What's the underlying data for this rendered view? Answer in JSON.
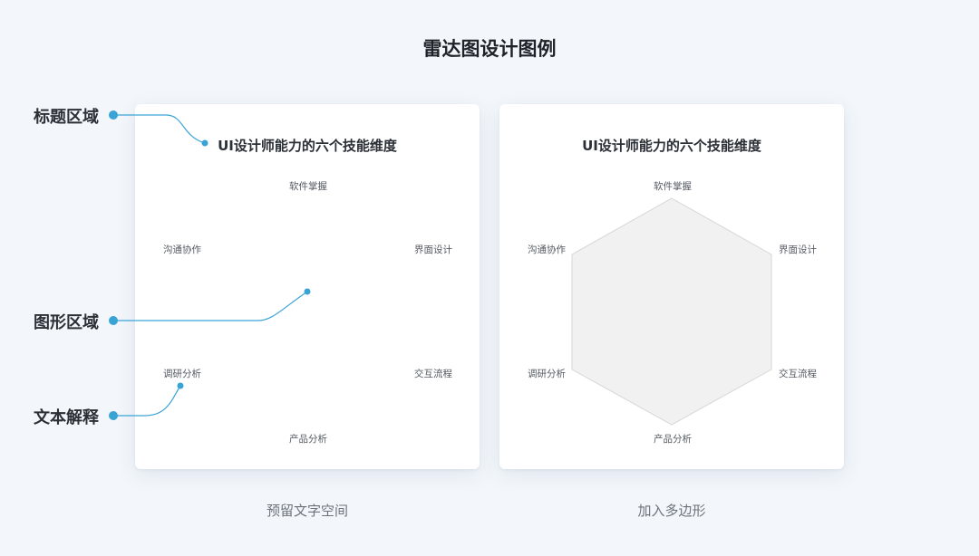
{
  "page": {
    "title": "雷达图设计图例"
  },
  "annotations": {
    "title_area": "标题区域",
    "graph_area": "图形区域",
    "text_area": "文本解释"
  },
  "chart": {
    "title": "UI设计师能力的六个技能维度",
    "dimensions": {
      "top": "软件掌握",
      "upper_right": "界面设计",
      "lower_right": "交互流程",
      "bottom": "产品分析",
      "lower_left": "调研分析",
      "upper_left": "沟通协作"
    }
  },
  "captions": {
    "left": "预留文字空间",
    "right": "加入多边形"
  },
  "colors": {
    "accent": "#3aa3d6",
    "background": "#f3f7fb",
    "polygon_fill": "#f1f1f1",
    "polygon_stroke": "#d6d6d6"
  }
}
